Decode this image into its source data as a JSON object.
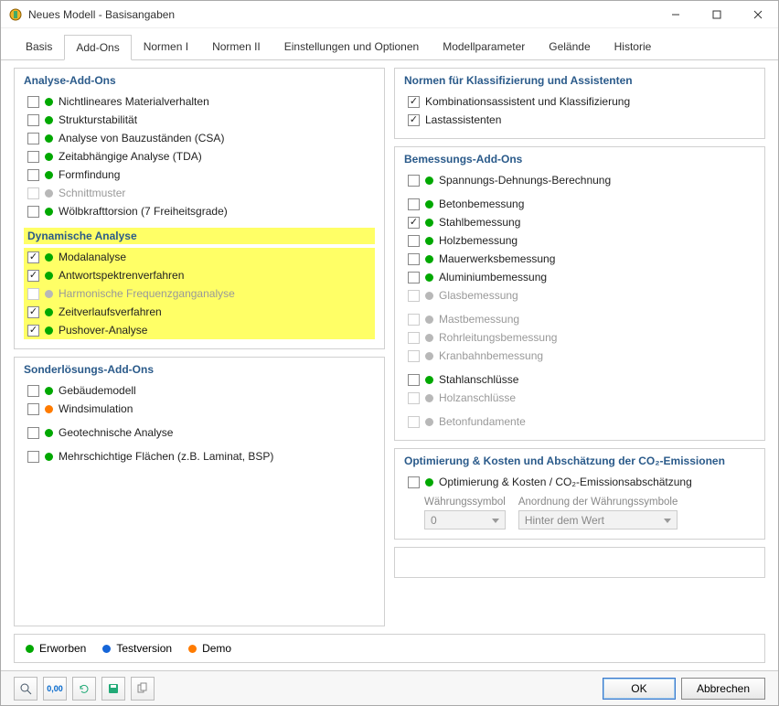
{
  "window": {
    "title": "Neues Modell - Basisangaben"
  },
  "tabs": [
    "Basis",
    "Add-Ons",
    "Normen I",
    "Normen II",
    "Einstellungen und Optionen",
    "Modellparameter",
    "Gelände",
    "Historie"
  ],
  "active_tab": 1,
  "left": {
    "g1_title": "Analyse-Add-Ons",
    "g1_items": [
      {
        "chk": false,
        "color": "green",
        "label": "Nichtlineares Materialverhalten"
      },
      {
        "chk": false,
        "color": "green",
        "label": "Strukturstabilität"
      },
      {
        "chk": false,
        "color": "green",
        "label": "Analyse von Bauzuständen (CSA)"
      },
      {
        "chk": false,
        "color": "green",
        "label": "Zeitabhängige Analyse (TDA)"
      },
      {
        "chk": false,
        "color": "green",
        "label": "Formfindung"
      },
      {
        "chk": false,
        "color": "gray",
        "label": "Schnittmuster",
        "disabled": true
      },
      {
        "chk": false,
        "color": "green",
        "label": "Wölbkrafttorsion (7 Freiheitsgrade)"
      }
    ],
    "dyn_title": "Dynamische Analyse",
    "dyn_items": [
      {
        "chk": true,
        "color": "green",
        "label": "Modalanalyse"
      },
      {
        "chk": true,
        "color": "green",
        "label": "Antwortspektrenverfahren"
      },
      {
        "chk": false,
        "color": "gray",
        "label": "Harmonische Frequenzganganalyse",
        "disabled": true
      },
      {
        "chk": true,
        "color": "green",
        "label": "Zeitverlaufsverfahren"
      },
      {
        "chk": true,
        "color": "green",
        "label": "Pushover-Analyse"
      }
    ],
    "g2_title": "Sonderlösungs-Add-Ons",
    "g2_items": [
      {
        "chk": false,
        "color": "green",
        "label": "Gebäudemodell"
      },
      {
        "chk": false,
        "color": "orange",
        "label": "Windsimulation"
      },
      {
        "spacer": true
      },
      {
        "chk": false,
        "color": "green",
        "label": "Geotechnische Analyse"
      },
      {
        "spacer": true
      },
      {
        "chk": false,
        "color": "green",
        "label": "Mehrschichtige Flächen (z.B. Laminat, BSP)"
      }
    ]
  },
  "right": {
    "g1_title": "Normen für Klassifizierung und Assistenten",
    "g1_items": [
      {
        "chk": true,
        "label": "Kombinationsassistent und Klassifizierung"
      },
      {
        "chk": true,
        "label": "Lastassistenten"
      }
    ],
    "g2_title": "Bemessungs-Add-Ons",
    "g2_items": [
      {
        "chk": false,
        "color": "green",
        "label": "Spannungs-Dehnungs-Berechnung"
      },
      {
        "spacer": true
      },
      {
        "chk": false,
        "color": "green",
        "label": "Betonbemessung"
      },
      {
        "chk": true,
        "color": "green",
        "label": "Stahlbemessung"
      },
      {
        "chk": false,
        "color": "green",
        "label": "Holzbemessung"
      },
      {
        "chk": false,
        "color": "green",
        "label": "Mauerwerksbemessung"
      },
      {
        "chk": false,
        "color": "green",
        "label": "Aluminiumbemessung"
      },
      {
        "chk": false,
        "color": "gray",
        "label": "Glasbemessung",
        "disabled": true
      },
      {
        "spacer": true
      },
      {
        "chk": false,
        "color": "gray",
        "label": "Mastbemessung",
        "disabled": true
      },
      {
        "chk": false,
        "color": "gray",
        "label": "Rohrleitungsbemessung",
        "disabled": true
      },
      {
        "chk": false,
        "color": "gray",
        "label": "Kranbahnbemessung",
        "disabled": true
      },
      {
        "spacer": true
      },
      {
        "chk": false,
        "color": "green",
        "label": "Stahlanschlüsse"
      },
      {
        "chk": false,
        "color": "gray",
        "label": "Holzanschlüsse",
        "disabled": true
      },
      {
        "spacer": true
      },
      {
        "chk": false,
        "color": "gray",
        "label": "Betonfundamente",
        "disabled": true
      }
    ],
    "g3_title": "Optimierung & Kosten und Abschätzung der CO₂-Emissionen",
    "g3_item": {
      "chk": false,
      "color": "green",
      "label": "Optimierung & Kosten / CO₂-Emissionsabschätzung"
    },
    "g3_sub": {
      "currency_label": "Währungssymbol",
      "currency_value": "0",
      "order_label": "Anordnung der Währungssymbole",
      "order_value": "Hinter dem Wert"
    }
  },
  "legend": {
    "erworben": "Erworben",
    "testversion": "Testversion",
    "demo": "Demo"
  },
  "buttons": {
    "ok": "OK",
    "cancel": "Abbrechen"
  }
}
